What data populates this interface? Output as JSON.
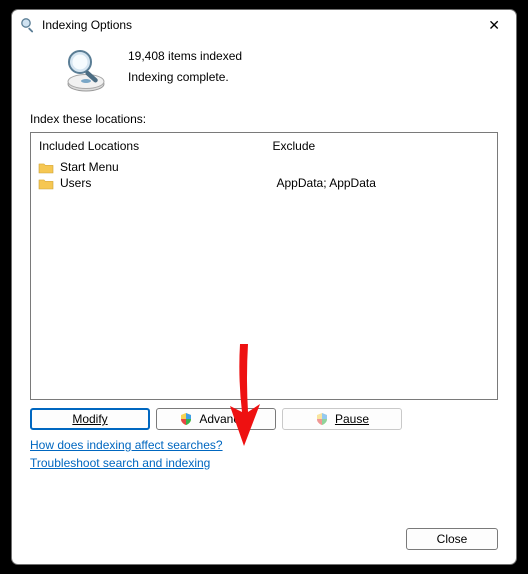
{
  "title": "Indexing Options",
  "status": {
    "count_line": "19,408 items indexed",
    "state_line": "Indexing complete."
  },
  "section_label": "Index these locations:",
  "columns": {
    "included_header": "Included Locations",
    "exclude_header": "Exclude"
  },
  "included": [
    {
      "label": "Start Menu",
      "exclude": ""
    },
    {
      "label": "Users",
      "exclude": "AppData; AppData"
    }
  ],
  "buttons": {
    "modify": "Modify",
    "advanced": "Advanced",
    "pause": "Pause",
    "close": "Close"
  },
  "links": {
    "help": "How does indexing affect searches?",
    "troubleshoot": "Troubleshoot search and indexing"
  },
  "accent_color": "#0067c0",
  "annotation": {
    "red_arrow": true
  }
}
